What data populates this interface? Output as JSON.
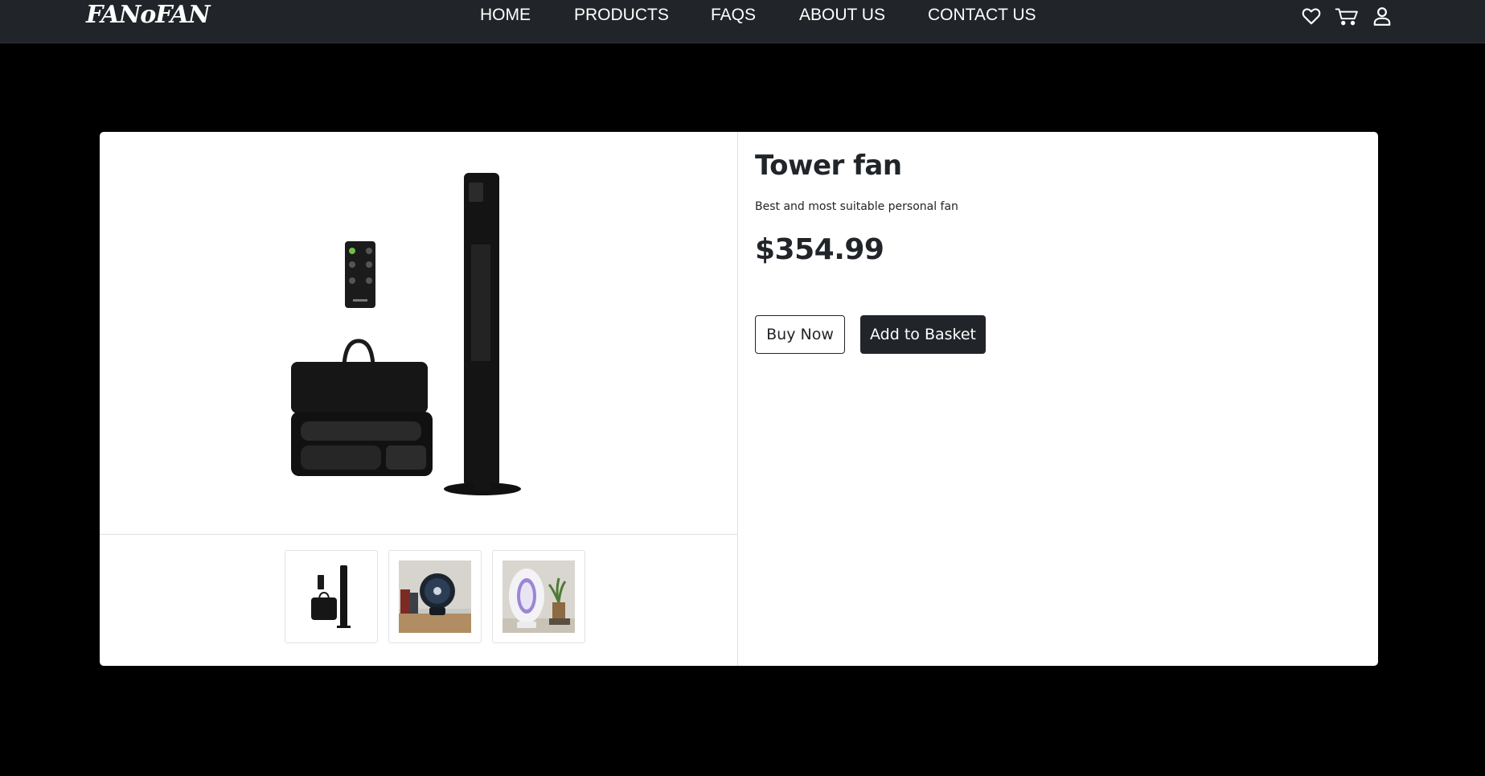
{
  "brand": {
    "logo_text": "FANoFAN"
  },
  "nav": {
    "links": [
      {
        "label": "HOME"
      },
      {
        "label": "PRODUCTS"
      },
      {
        "label": "FAQS"
      },
      {
        "label": "ABOUT US"
      },
      {
        "label": "CONTACT US"
      }
    ],
    "icons": [
      "heart-icon",
      "cart-icon",
      "user-icon"
    ]
  },
  "product": {
    "title": "Tower fan",
    "description": "Best and most suitable personal fan",
    "price": "$354.99",
    "thumbnails": [
      "tower-fan-set",
      "desk-clip-fan",
      "bladeless-fan"
    ]
  },
  "actions": {
    "buy_label": "Buy Now",
    "basket_label": "Add to Basket"
  },
  "colors": {
    "navbar_bg": "#212529",
    "page_bg": "#000000",
    "card_bg": "#ffffff",
    "primary_button_bg": "#212529"
  }
}
